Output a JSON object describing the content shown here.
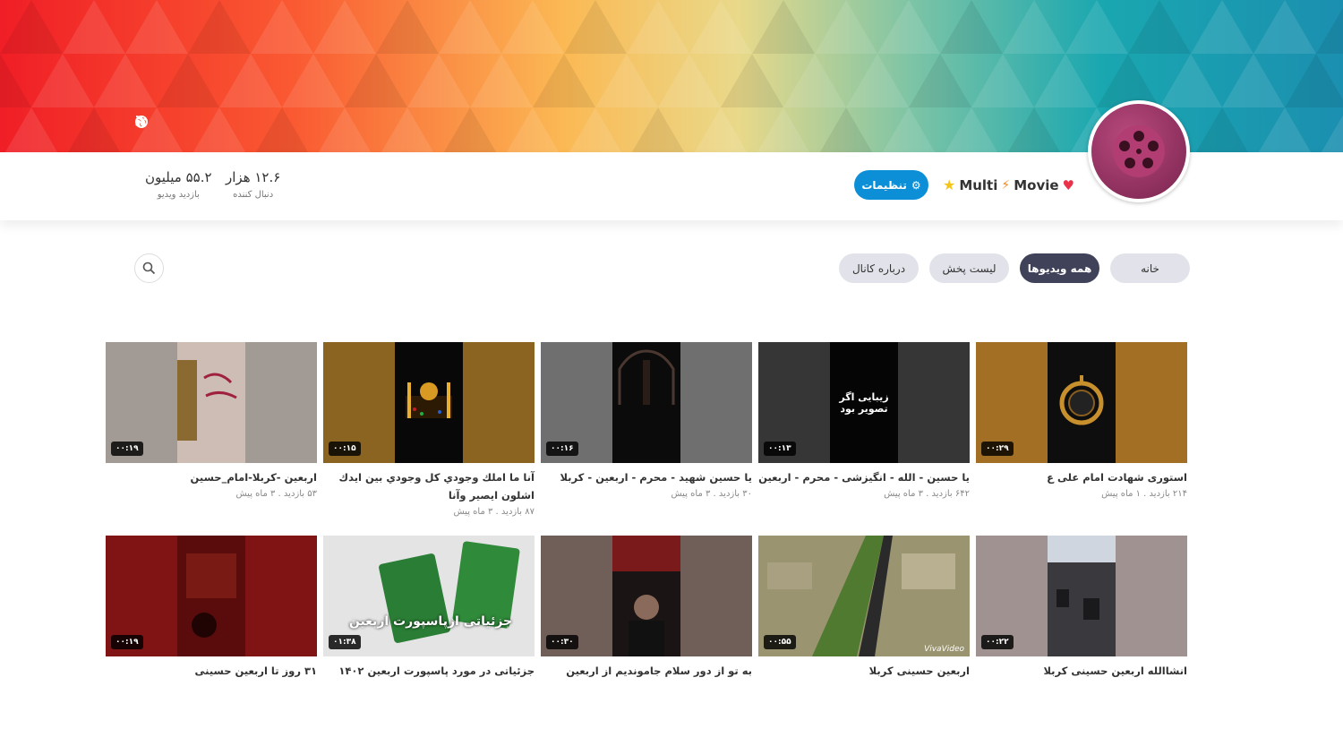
{
  "banner": {
    "icons": [
      "globe-icon",
      "rss-icon"
    ]
  },
  "channel": {
    "name_parts": [
      "Movie",
      "Multi"
    ],
    "settings_label": "تنظیمات",
    "stats": [
      {
        "value": "۱۲.۶ هزار",
        "label": "دنبال کننده"
      },
      {
        "value": "۵۵.۲ میلیون",
        "label": "بازدید ویدیو"
      }
    ]
  },
  "tabs": [
    {
      "label": "خانه",
      "active": false
    },
    {
      "label": "همه ویدیوها",
      "active": true
    },
    {
      "label": "لیست پخش",
      "active": false
    },
    {
      "label": "درباره کانال",
      "active": false
    }
  ],
  "videos": [
    {
      "title": "استوری شهادت امام علی ع",
      "views": "۲۱۴ بازدید",
      "age": "۱ ماه پیش",
      "duration": "۰۰:۲۹"
    },
    {
      "title": "یا حسین - الله - انگیزشی - محرم - اربعین",
      "views": "۶۴۲ بازدید",
      "age": "۳ ماه پیش",
      "duration": "۰۰:۱۳",
      "overlay": "زیبایی اگر تصویر بود"
    },
    {
      "title": "یا حسین شهید - محرم - اربعین - کربلا",
      "views": "۳۰ بازدید",
      "age": "۳ ماه پیش",
      "duration": "۰۰:۱۶"
    },
    {
      "title": "آنا ما املك وجودي كل وجودي بين ايدك اشلون ايصير وآنا",
      "views": "۸۷ بازدید",
      "age": "۳ ماه پیش",
      "duration": "۰۰:۱۵"
    },
    {
      "title": "اربعین -کربلا-امام_حسین",
      "views": "۵۳ بازدید",
      "age": "۳ ماه پیش",
      "duration": "۰۰:۱۹"
    },
    {
      "title": "انشاالله اربعین حسینی کربلا",
      "duration": "۰۰:۲۲"
    },
    {
      "title": "اربعین حسینی کربلا",
      "duration": "۰۰:۵۵",
      "overlay": "VivaVideo"
    },
    {
      "title": "به تو از دور سلام جاموندیم از اربعین",
      "duration": "۰۰:۳۰"
    },
    {
      "title": "جزئیاتی در مورد پاسپورت اربعین ۱۴۰۲",
      "duration": "۰۱:۳۸",
      "overlay": "جزئیاتی ازپاسپورت اربعین"
    },
    {
      "title": "۳۱ روز تا اربعین حسینی",
      "duration": "۰۰:۱۹"
    }
  ]
}
